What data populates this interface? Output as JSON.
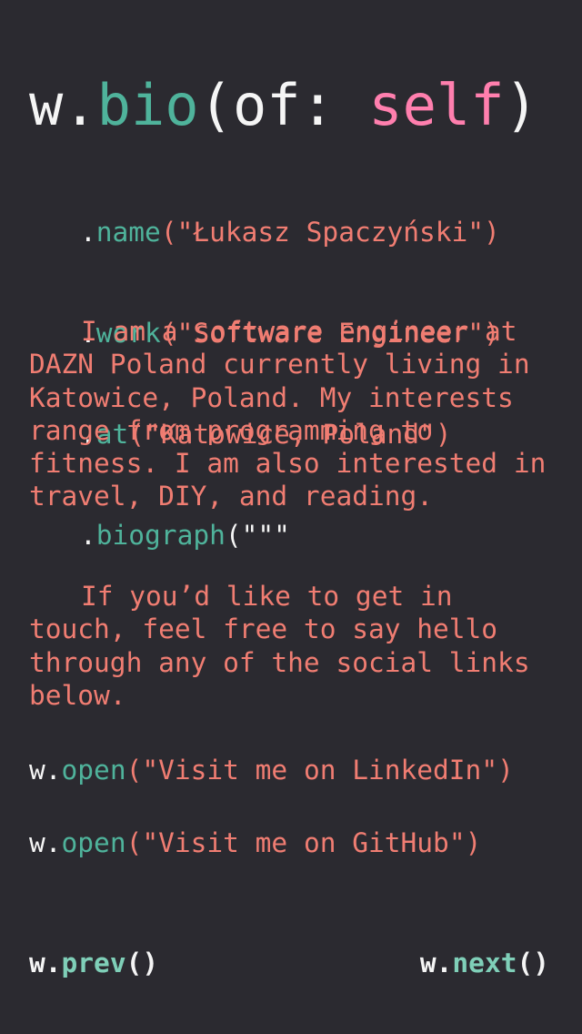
{
  "title": {
    "object": "w",
    "dot": ".",
    "method": "bio",
    "open_paren": "(",
    "param": "of: ",
    "value": "self",
    "close_paren": ")"
  },
  "chain": [
    {
      "dot": ".",
      "method": "name",
      "open": "(\"",
      "value": "Łukasz Spaczyński",
      "close": "\")"
    },
    {
      "dot": ".",
      "method": "work",
      "open": "(\"",
      "value": "Software Engineer",
      "close": "\")"
    },
    {
      "dot": ".",
      "method": "at",
      "open": "(\"",
      "value": "Katowice, Poland",
      "close": "\")"
    },
    {
      "dot": ".",
      "method": "biograph",
      "open": "(\"\"\"",
      "value": "",
      "close": ""
    }
  ],
  "biography": {
    "paragraph_1": "I am a software engineer at DAZN Poland currently living in Katowice, Poland. My interests range from programming to fitness. I am also interested in travel, DIY, and reading.",
    "paragraph_2": "If you’d like to get in touch, feel free to say hello through any of the social links below."
  },
  "links": {
    "linkedin": {
      "object": "w",
      "dot": ".",
      "method": "open",
      "open": "(\"",
      "label": "Visit me on LinkedIn",
      "close": "\")"
    },
    "github": {
      "object": "w",
      "dot": ".",
      "method": "open",
      "open": "(\"",
      "label": "Visit me on GitHub",
      "close": "\")"
    }
  },
  "nav": {
    "prev": {
      "object": "w",
      "dot": ".",
      "method": "prev",
      "parens": "()"
    },
    "next": {
      "object": "w",
      "dot": ".",
      "method": "next",
      "parens": "()"
    }
  },
  "colors": {
    "background": "#2b2a30",
    "text": "#f5f5f5",
    "method": "#4fb39b",
    "keyword_value": "#ff7fae",
    "string": "#f07d72"
  }
}
